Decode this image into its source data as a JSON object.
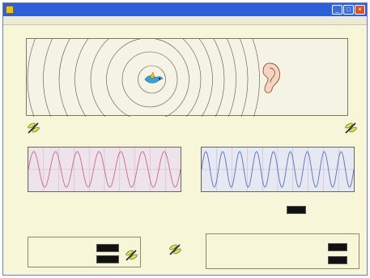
{
  "window": {
    "title": ""
  },
  "menu": {
    "items": [
      "",
      "",
      "",
      ""
    ]
  },
  "source": {
    "speed_readout": ""
  },
  "observer": {
    "caption_top": "",
    "caption_sub": ""
  },
  "left_plot": {
    "freq_label": "",
    "time_axis_label": "",
    "y_axis_label": "",
    "x_ticks": []
  },
  "right_plot": {
    "freq_label": "",
    "time_axis_label": "",
    "y_axis_label": "",
    "x_ticks": [],
    "observer_speed_label": "",
    "observer_speed_value": ""
  },
  "source_box": {
    "legend": "",
    "speed_label": "",
    "speed_value": "",
    "freq_label": "",
    "freq_value": ""
  },
  "observer_box": {
    "legend": "",
    "approach_label": "",
    "approach_value": "",
    "recede_label": "",
    "recede_value": ""
  },
  "colors": {
    "titlebar": "#2d5fd6",
    "window_bg": "#f7f6d8",
    "left_wave": "#c46a8a",
    "right_wave": "#5a6fb8"
  },
  "icons": {
    "source": "bird-icon",
    "observer": "ear-icon",
    "speakers": "dragonfly-icon"
  }
}
